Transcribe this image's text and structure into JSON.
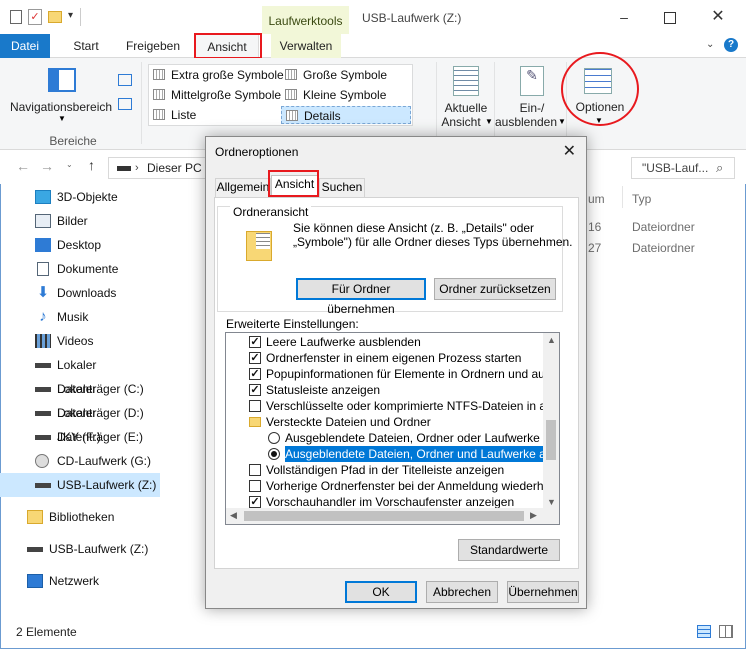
{
  "window": {
    "context_tab": "Laufwerktools",
    "title": "USB-Laufwerk (Z:)"
  },
  "tabs": [
    "Datei",
    "Start",
    "Freigeben",
    "Ansicht",
    "Verwalten"
  ],
  "ribbon": {
    "nav_pane": "Navigationsbereich",
    "group_panes": "Bereiche",
    "layouts": [
      "Extra große Symbole",
      "Große Symbole",
      "Mittelgroße Symbole",
      "Kleine Symbole",
      "Liste",
      "Details"
    ],
    "current_view_1": "Aktuelle",
    "current_view_2": "Ansicht",
    "show_hide_1": "Ein-/",
    "show_hide_2": "ausblenden",
    "options": "Optionen"
  },
  "nav": {
    "address": "Dieser PC",
    "search_placeholder": "\"USB-Lauf..."
  },
  "sidebar": {
    "items": [
      "3D-Objekte",
      "Bilder",
      "Desktop",
      "Dokumente",
      "Downloads",
      "Musik",
      "Videos",
      "Lokaler Datenträger (C:)",
      "Lokaler Datenträger (D:)",
      "Lokaler Datenträger (E:)",
      "JKY (F:)",
      "CD-Laufwerk (G:)",
      "USB-Laufwerk (Z:)"
    ],
    "libraries": "Bibliotheken",
    "usb": "USB-Laufwerk (Z:)",
    "network": "Netzwerk"
  },
  "content": {
    "col_date_tail": "um",
    "col_type": "Typ",
    "rows": [
      {
        "date_tail": "16",
        "type": "Dateiordner"
      },
      {
        "date_tail": "27",
        "type": "Dateiordner"
      }
    ]
  },
  "status": "2 Elemente",
  "dialog": {
    "title": "Ordneroptionen",
    "tabs": [
      "Allgemein",
      "Ansicht",
      "Suchen"
    ],
    "folder_view_title": "Ordneransicht",
    "folder_view_text_1": "Sie können diese Ansicht (z. B. „Details\" oder",
    "folder_view_text_2": "„Symbole\") für alle Ordner dieses Typs übernehmen.",
    "apply_btn": "Für Ordner übernehmen",
    "reset_btn": "Ordner zurücksetzen",
    "advanced_label": "Erweiterte Einstellungen:",
    "advanced": [
      {
        "kind": "check",
        "checked": true,
        "text": "Leere Laufwerke ausblenden"
      },
      {
        "kind": "check",
        "checked": true,
        "text": "Ordnerfenster in einem eigenen Prozess starten"
      },
      {
        "kind": "check",
        "checked": true,
        "text": "Popupinformationen für Elemente in Ordnern und auf dem D"
      },
      {
        "kind": "check",
        "checked": true,
        "text": "Statusleiste anzeigen"
      },
      {
        "kind": "check",
        "checked": false,
        "text": "Verschlüsselte oder komprimierte NTFS-Dateien in anderer"
      },
      {
        "kind": "folder",
        "text": "Versteckte Dateien und Ordner"
      },
      {
        "kind": "radio",
        "checked": false,
        "text": "Ausgeblendete Dateien, Ordner oder Laufwerke nicht a"
      },
      {
        "kind": "radio",
        "checked": true,
        "text": "Ausgeblendete Dateien, Ordner und Laufwerke anzeig"
      },
      {
        "kind": "check",
        "checked": false,
        "text": "Vollständigen Pfad in der Titelleiste anzeigen"
      },
      {
        "kind": "check",
        "checked": false,
        "text": "Vorherige Ordnerfenster bei der Anmeldung wiederherstellen"
      },
      {
        "kind": "check",
        "checked": true,
        "text": "Vorschauhandler im Vorschaufenster anzeigen"
      }
    ],
    "defaults_btn": "Standardwerte",
    "ok": "OK",
    "cancel": "Abbrechen",
    "apply": "Übernehmen"
  },
  "colors": {
    "accent": "#1979ca",
    "highlight_red": "#e8191e",
    "selection": "#0078d7"
  }
}
